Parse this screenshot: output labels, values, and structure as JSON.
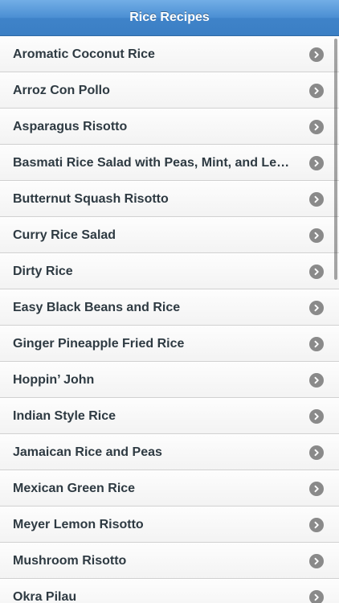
{
  "header": {
    "title": "Rice Recipes"
  },
  "recipes": [
    {
      "label": "Aromatic Coconut Rice"
    },
    {
      "label": "Arroz Con Pollo"
    },
    {
      "label": "Asparagus Risotto"
    },
    {
      "label": "Basmati Rice Salad with Peas, Mint, and Lem…"
    },
    {
      "label": "Butternut Squash Risotto"
    },
    {
      "label": "Curry Rice Salad"
    },
    {
      "label": "Dirty Rice"
    },
    {
      "label": "Easy Black Beans and Rice"
    },
    {
      "label": "Ginger Pineapple Fried Rice"
    },
    {
      "label": "Hoppin’ John"
    },
    {
      "label": "Indian Style Rice"
    },
    {
      "label": "Jamaican Rice and Peas"
    },
    {
      "label": "Mexican Green Rice"
    },
    {
      "label": "Meyer Lemon Risotto"
    },
    {
      "label": "Mushroom Risotto"
    },
    {
      "label": "Okra Pilau"
    }
  ],
  "icons": {
    "row_disclosure": "chevron-right-circle-icon"
  },
  "colors": {
    "header_accent": "#3b7fc4",
    "item_text": "#2e3a42",
    "disclosure": "#8a8a8a"
  }
}
